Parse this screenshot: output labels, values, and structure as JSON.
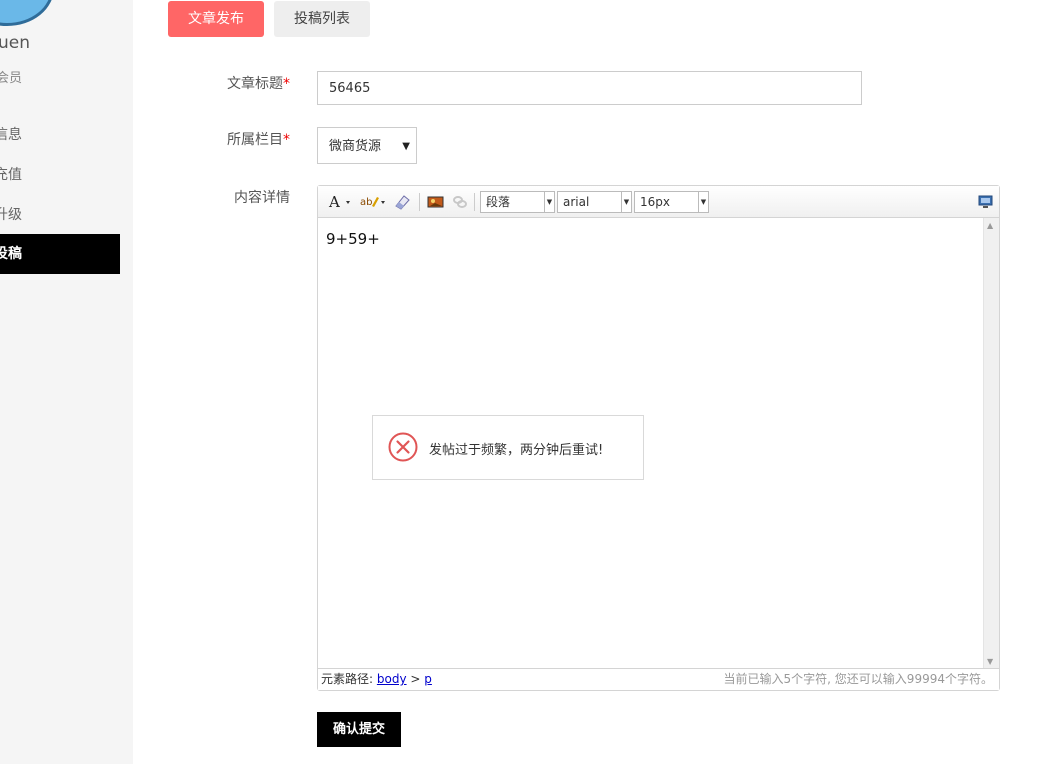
{
  "sidebar": {
    "username": "uen",
    "user_type": "会员",
    "items": [
      {
        "label": "信息"
      },
      {
        "label": "充值"
      },
      {
        "label": "升级"
      },
      {
        "label": "投稿"
      }
    ]
  },
  "tabs": [
    {
      "label": "文章发布"
    },
    {
      "label": "投稿列表"
    }
  ],
  "form": {
    "title_label": "文章标题",
    "title_value": "56465",
    "category_label": "所属栏目",
    "category_value": "微商货源",
    "content_label": "内容详情",
    "required_mark": "*"
  },
  "editor": {
    "toolbar": {
      "paragraph": "段落",
      "font_family": "arial",
      "font_size": "16px",
      "icons": [
        "font-color-icon",
        "highlight-icon",
        "eraser-icon",
        "image-icon",
        "link-icon",
        "source-view-icon"
      ]
    },
    "content": "9+59+",
    "status": {
      "path_label": "元素路径:",
      "path_body": "body",
      "path_sep": ">",
      "path_p": "p",
      "count_text": "当前已输入5个字符, 您还可以输入99994个字符。"
    }
  },
  "toast": {
    "message": "发帖过于频繁，两分钟后重试!"
  },
  "submit_label": "确认提交",
  "colors": {
    "accent_tab": "#ff6666",
    "active_menu": "#000000",
    "error_icon": "#e05555"
  }
}
